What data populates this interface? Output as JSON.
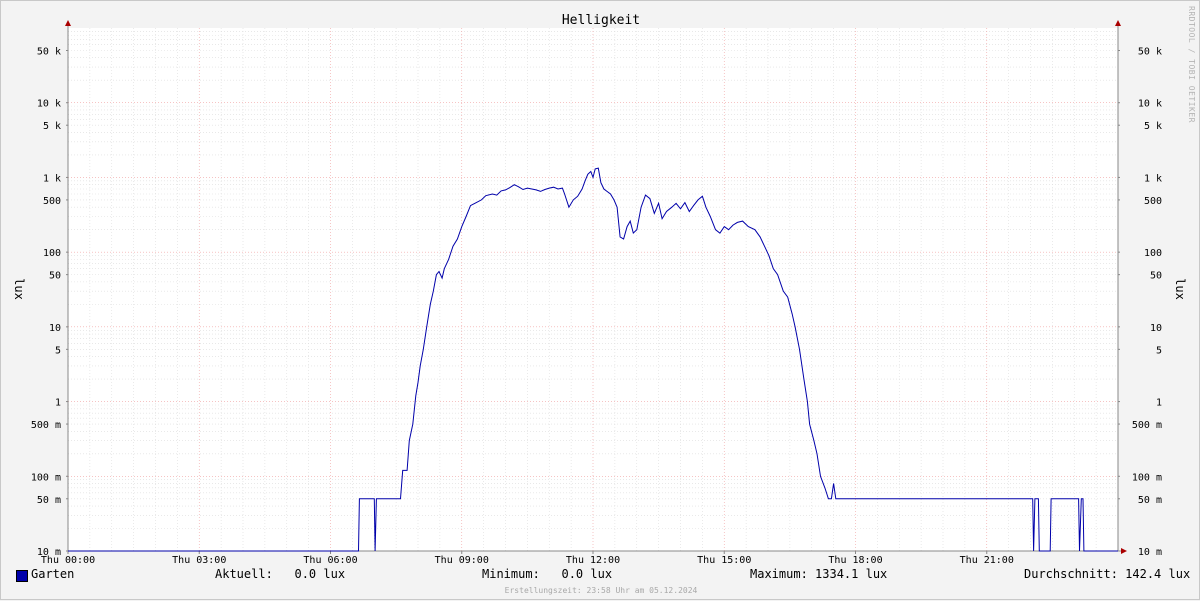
{
  "chart_data": {
    "type": "line",
    "title": "Helligkeit",
    "ylabel": "lux",
    "y_scale": "log",
    "ylim": [
      0.01,
      100000
    ],
    "xlim_hours": [
      0,
      24
    ],
    "x_ticks": [
      {
        "h": 0,
        "label": "Thu 00:00"
      },
      {
        "h": 3,
        "label": "Thu 03:00"
      },
      {
        "h": 6,
        "label": "Thu 06:00"
      },
      {
        "h": 9,
        "label": "Thu 09:00"
      },
      {
        "h": 12,
        "label": "Thu 12:00"
      },
      {
        "h": 15,
        "label": "Thu 15:00"
      },
      {
        "h": 18,
        "label": "Thu 18:00"
      },
      {
        "h": 21,
        "label": "Thu 21:00"
      }
    ],
    "y_ticks": [
      {
        "v": 0.01,
        "label": "10 m"
      },
      {
        "v": 0.05,
        "label": "50 m"
      },
      {
        "v": 0.1,
        "label": "100 m"
      },
      {
        "v": 0.5,
        "label": "500 m"
      },
      {
        "v": 1,
        "label": "1"
      },
      {
        "v": 5,
        "label": "5"
      },
      {
        "v": 10,
        "label": "10"
      },
      {
        "v": 50,
        "label": "50"
      },
      {
        "v": 100,
        "label": "100"
      },
      {
        "v": 500,
        "label": "500"
      },
      {
        "v": 1000,
        "label": "1 k"
      },
      {
        "v": 5000,
        "label": "5 k"
      },
      {
        "v": 10000,
        "label": "10 k"
      },
      {
        "v": 50000,
        "label": "50 k"
      }
    ],
    "grid": true,
    "series": [
      {
        "name": "Garten",
        "color": "#0000aa",
        "points": [
          [
            0,
            0.01
          ],
          [
            6.64,
            0.01
          ],
          [
            6.66,
            0.05
          ],
          [
            7.0,
            0.05
          ],
          [
            7.02,
            0.01
          ],
          [
            7.05,
            0.05
          ],
          [
            7.6,
            0.05
          ],
          [
            7.65,
            0.12
          ],
          [
            7.75,
            0.12
          ],
          [
            7.8,
            0.3
          ],
          [
            7.88,
            0.5
          ],
          [
            7.95,
            1.2
          ],
          [
            8.0,
            1.8
          ],
          [
            8.05,
            3.0
          ],
          [
            8.12,
            5
          ],
          [
            8.2,
            10
          ],
          [
            8.28,
            20
          ],
          [
            8.35,
            30
          ],
          [
            8.42,
            50
          ],
          [
            8.48,
            55
          ],
          [
            8.55,
            45
          ],
          [
            8.6,
            60
          ],
          [
            8.7,
            80
          ],
          [
            8.8,
            120
          ],
          [
            8.9,
            150
          ],
          [
            9.0,
            220
          ],
          [
            9.1,
            300
          ],
          [
            9.2,
            420
          ],
          [
            9.3,
            450
          ],
          [
            9.45,
            500
          ],
          [
            9.55,
            570
          ],
          [
            9.7,
            600
          ],
          [
            9.8,
            580
          ],
          [
            9.9,
            660
          ],
          [
            10.0,
            680
          ],
          [
            10.1,
            730
          ],
          [
            10.2,
            800
          ],
          [
            10.3,
            750
          ],
          [
            10.4,
            690
          ],
          [
            10.5,
            720
          ],
          [
            10.6,
            700
          ],
          [
            10.7,
            680
          ],
          [
            10.8,
            650
          ],
          [
            10.9,
            690
          ],
          [
            11.0,
            720
          ],
          [
            11.1,
            740
          ],
          [
            11.2,
            700
          ],
          [
            11.3,
            720
          ],
          [
            11.35,
            600
          ],
          [
            11.45,
            400
          ],
          [
            11.55,
            500
          ],
          [
            11.65,
            560
          ],
          [
            11.75,
            700
          ],
          [
            11.82,
            900
          ],
          [
            11.88,
            1100
          ],
          [
            11.95,
            1200
          ],
          [
            12.0,
            1000
          ],
          [
            12.05,
            1300
          ],
          [
            12.12,
            1334
          ],
          [
            12.18,
            850
          ],
          [
            12.25,
            700
          ],
          [
            12.32,
            650
          ],
          [
            12.4,
            600
          ],
          [
            12.48,
            500
          ],
          [
            12.55,
            400
          ],
          [
            12.62,
            160
          ],
          [
            12.7,
            150
          ],
          [
            12.78,
            220
          ],
          [
            12.85,
            260
          ],
          [
            12.92,
            180
          ],
          [
            13.0,
            200
          ],
          [
            13.1,
            400
          ],
          [
            13.2,
            580
          ],
          [
            13.3,
            520
          ],
          [
            13.4,
            330
          ],
          [
            13.5,
            450
          ],
          [
            13.58,
            280
          ],
          [
            13.68,
            350
          ],
          [
            13.8,
            400
          ],
          [
            13.9,
            450
          ],
          [
            14.0,
            380
          ],
          [
            14.1,
            460
          ],
          [
            14.2,
            350
          ],
          [
            14.3,
            420
          ],
          [
            14.4,
            500
          ],
          [
            14.5,
            560
          ],
          [
            14.58,
            400
          ],
          [
            14.68,
            300
          ],
          [
            14.8,
            200
          ],
          [
            14.9,
            180
          ],
          [
            15.0,
            220
          ],
          [
            15.1,
            200
          ],
          [
            15.2,
            230
          ],
          [
            15.3,
            250
          ],
          [
            15.42,
            260
          ],
          [
            15.55,
            220
          ],
          [
            15.7,
            200
          ],
          [
            15.82,
            160
          ],
          [
            15.92,
            120
          ],
          [
            16.02,
            90
          ],
          [
            16.12,
            60
          ],
          [
            16.22,
            50
          ],
          [
            16.35,
            30
          ],
          [
            16.45,
            25
          ],
          [
            16.55,
            15
          ],
          [
            16.62,
            10
          ],
          [
            16.72,
            5
          ],
          [
            16.82,
            2
          ],
          [
            16.9,
            1
          ],
          [
            16.95,
            0.5
          ],
          [
            17.05,
            0.3
          ],
          [
            17.12,
            0.2
          ],
          [
            17.2,
            0.1
          ],
          [
            17.3,
            0.07
          ],
          [
            17.38,
            0.05
          ],
          [
            17.45,
            0.05
          ],
          [
            17.5,
            0.08
          ],
          [
            17.55,
            0.05
          ],
          [
            22.05,
            0.05
          ],
          [
            22.07,
            0.01
          ],
          [
            22.1,
            0.05
          ],
          [
            22.18,
            0.05
          ],
          [
            22.2,
            0.01
          ],
          [
            22.45,
            0.01
          ],
          [
            22.47,
            0.05
          ],
          [
            23.1,
            0.05
          ],
          [
            23.12,
            0.01
          ],
          [
            23.16,
            0.05
          ],
          [
            23.2,
            0.05
          ],
          [
            23.22,
            0.01
          ],
          [
            24.0,
            0.01
          ]
        ]
      }
    ]
  },
  "legend": {
    "series_name": "Garten",
    "color": "#0000aa",
    "current": "Aktuell:   0.0 lux",
    "minimum": "Minimum:   0.0 lux",
    "maximum": "Maximum: 1334.1 lux",
    "average": "Durchschnitt: 142.4 lux"
  },
  "footer": "Erstellungszeit: 23:58 Uhr am 05.12.2024",
  "watermark": "RRDTOOL / TOBI OETIKER"
}
